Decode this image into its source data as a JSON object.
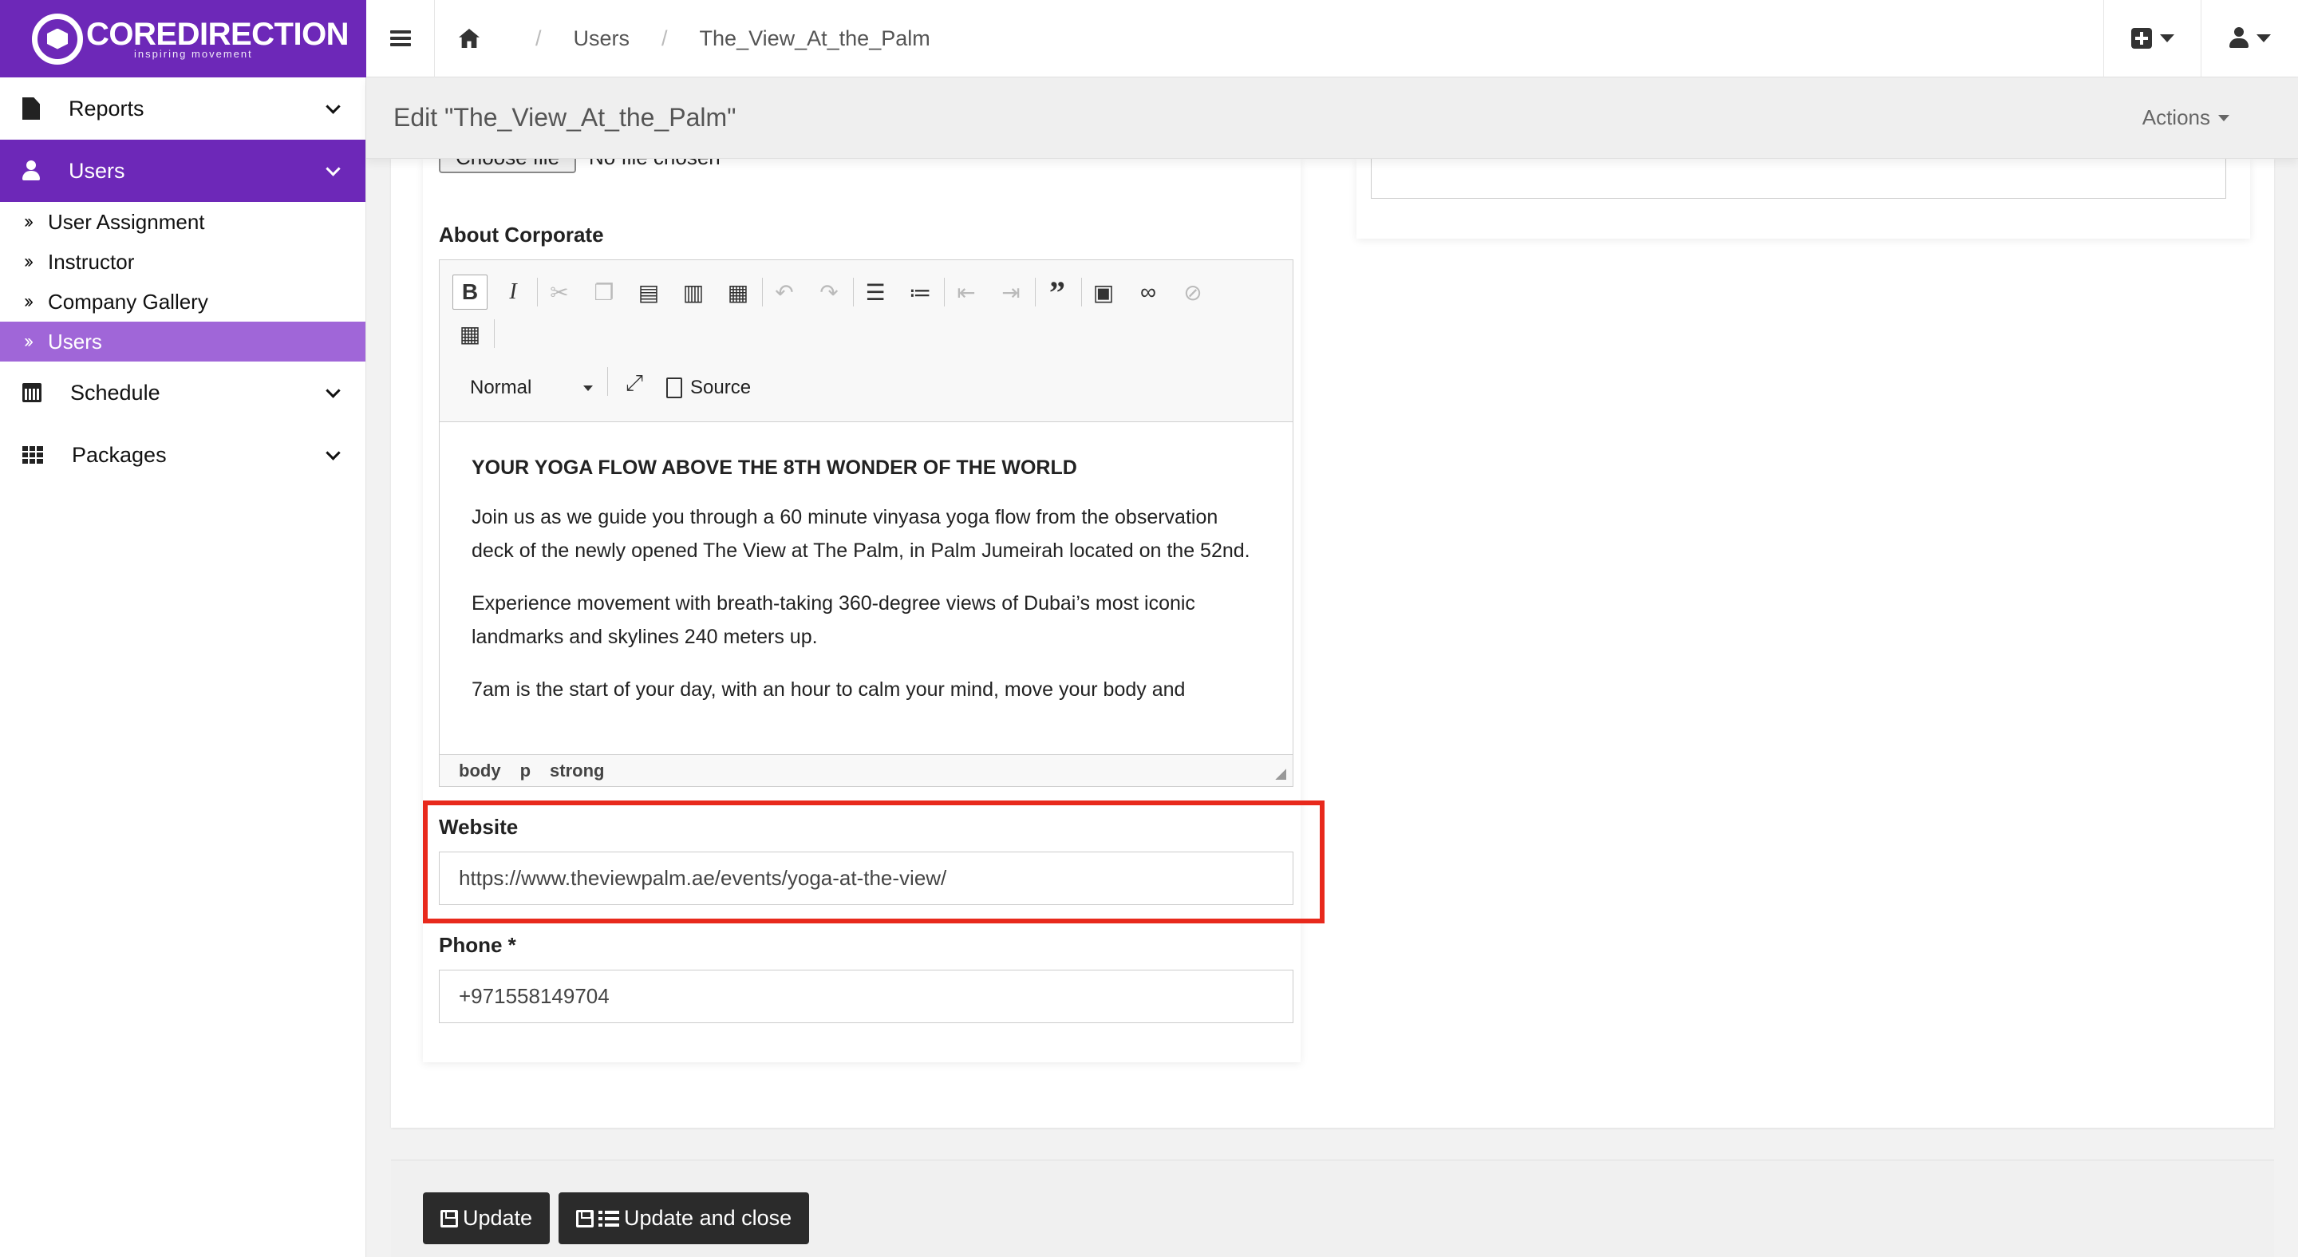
{
  "brand": {
    "name": "COREDIRECTION",
    "tagline": "inspiring movement",
    "color": "#6d28b8"
  },
  "breadcrumb": [
    "Users",
    "The_View_At_the_Palm"
  ],
  "sidebar": {
    "items": [
      {
        "label": "Reports",
        "icon": "file-icon"
      },
      {
        "label": "Users",
        "icon": "user-icon",
        "active": true
      },
      {
        "label": "Schedule",
        "icon": "calendar-icon"
      },
      {
        "label": "Packages",
        "icon": "grid-icon"
      }
    ],
    "sub_items": [
      "User Assignment",
      "Instructor",
      "Company Gallery",
      "Users"
    ]
  },
  "page": {
    "title": "Edit \"The_View_At_the_Palm\"",
    "actions_label": "Actions"
  },
  "form": {
    "file_button": "Choose file",
    "file_status": "No file chosen",
    "about_label": "About Corporate",
    "editor": {
      "format": "Normal",
      "source_label": "Source",
      "heading": "YOUR YOGA FLOW ABOVE THE 8TH WONDER OF THE WORLD",
      "paragraphs": [
        "Join us as we guide you through a 60 minute vinyasa yoga flow from the observation deck of the newly opened The View at The Palm, in Palm Jumeirah located on the 52nd.",
        "Experience movement with breath-taking 360-degree views of Dubai’s most iconic landmarks and skylines 240 meters up.",
        "7am is the start of your day, with an hour to calm your mind, move your body and"
      ],
      "path": [
        "body",
        "p",
        "strong"
      ]
    },
    "website_label": "Website",
    "website_value": "https://www.theviewpalm.ae/events/yoga-at-the-view/",
    "phone_label": "Phone *",
    "phone_value": "+971558149704"
  },
  "footer": {
    "update_label": "Update",
    "update_close_label": "Update and close"
  },
  "highlight_color": "#e8291c"
}
